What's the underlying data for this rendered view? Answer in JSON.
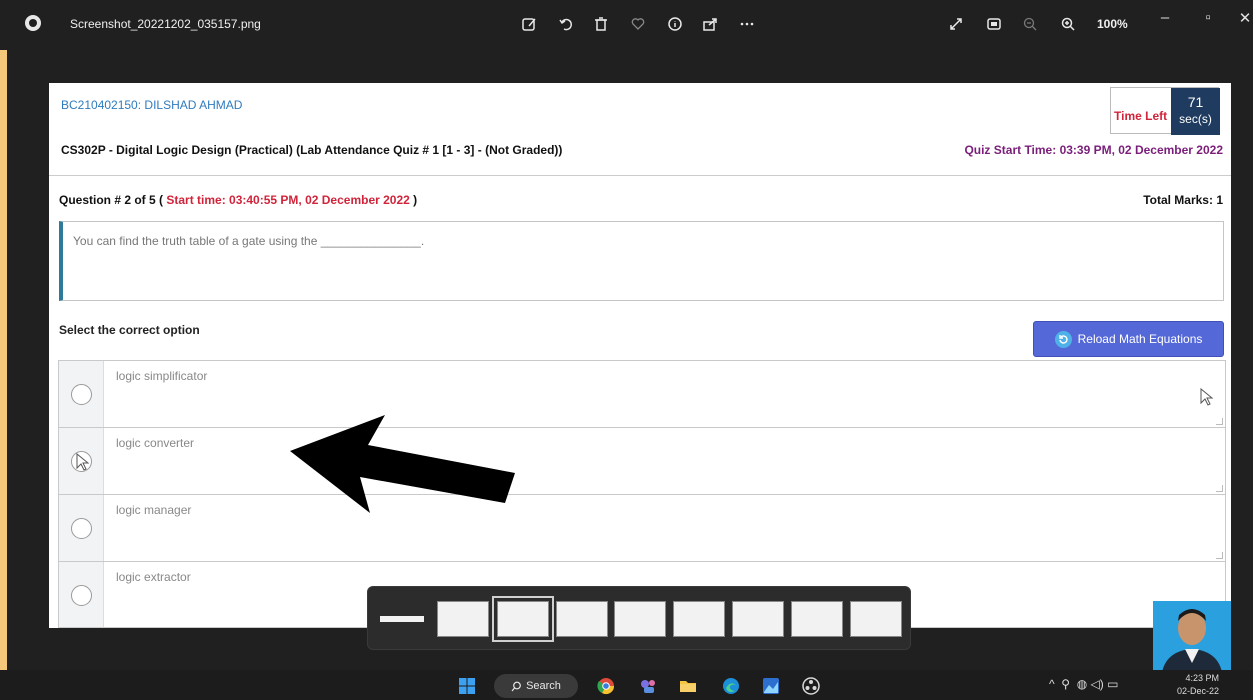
{
  "viewer": {
    "file_name": "Screenshot_20221202_035157.png",
    "zoom": "100%"
  },
  "quiz": {
    "student": "BC210402150: DILSHAD AHMAD",
    "course": "CS302P - Digital Logic Design (Practical) (Lab Attendance Quiz # 1 [1 - 3] - (Not Graded))",
    "timer_label": "Time Left",
    "timer_value": "71",
    "timer_unit": "sec(s)",
    "quiz_start": "Quiz Start Time: 03:39 PM, 02 December 2022",
    "question_prefix": "Question # 2 of 5 (",
    "question_start": "Start time: 03:40:55 PM, 02 December 2022",
    "question_suffix": ")",
    "total_marks": "Total Marks: 1",
    "question_text": "You can find the truth table of a gate using the _______________.",
    "select_label": "Select the correct option",
    "reload_label": "Reload Math Equations",
    "options": [
      "logic simplificator",
      "logic converter",
      "logic manager",
      "logic extractor"
    ]
  },
  "taskbar": {
    "search_label": "Search",
    "time": "4:23 PM",
    "date": "02-Dec-22"
  },
  "colors": {
    "accent_blue": "#5468d8",
    "alert_red": "#d0243a",
    "timer_bg": "#1f3b5f",
    "student_blue": "#2f7bbd"
  }
}
